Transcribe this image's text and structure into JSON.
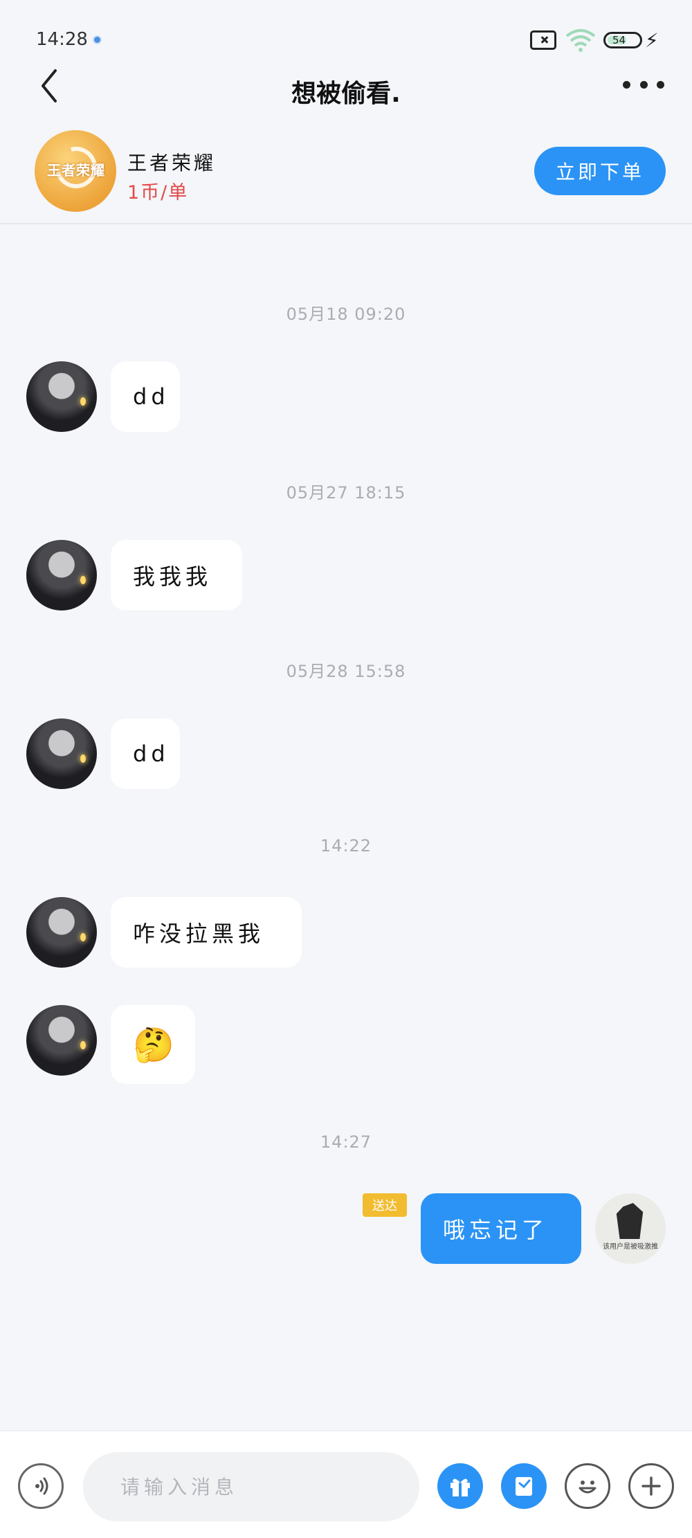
{
  "status_bar": {
    "time": "14:28",
    "battery": "54",
    "icons": [
      "notification-dot-icon",
      "sim-blocked-icon",
      "wifi-icon",
      "battery-icon",
      "charging-icon"
    ]
  },
  "header": {
    "title": "想被偷看.",
    "back_icon": "chevron-left-icon",
    "more_icon": "more-dots-icon"
  },
  "product": {
    "logo_text": "王者荣耀",
    "name": "王者荣耀",
    "price": "1币/单",
    "order_button": "立即下单"
  },
  "messages": [
    {
      "timestamp": "05月18 09:20",
      "text": "dd",
      "sender": "other"
    },
    {
      "timestamp": "05月27 18:15",
      "text": "我我我",
      "sender": "other"
    },
    {
      "timestamp": "05月28 15:58",
      "text": "dd",
      "sender": "other"
    },
    {
      "timestamp": "14:22",
      "text": "咋没拉黑我",
      "sender": "other"
    },
    {
      "timestamp": "",
      "text": "🤔",
      "sender": "other"
    },
    {
      "timestamp": "14:27",
      "text": "哦忘记了",
      "sender": "me",
      "status": "送达"
    }
  ],
  "my_avatar_caption": "该用户是被吸激推",
  "input": {
    "placeholder": "请输入消息",
    "value": ""
  },
  "bottom_icons": [
    "voice-icon",
    "gift-icon",
    "coupon-icon",
    "emoji-icon",
    "plus-icon"
  ],
  "colors": {
    "accent": "#2b93f5",
    "price": "#e24a4a",
    "badge": "#f2bc30",
    "background": "#f4f6f9"
  }
}
